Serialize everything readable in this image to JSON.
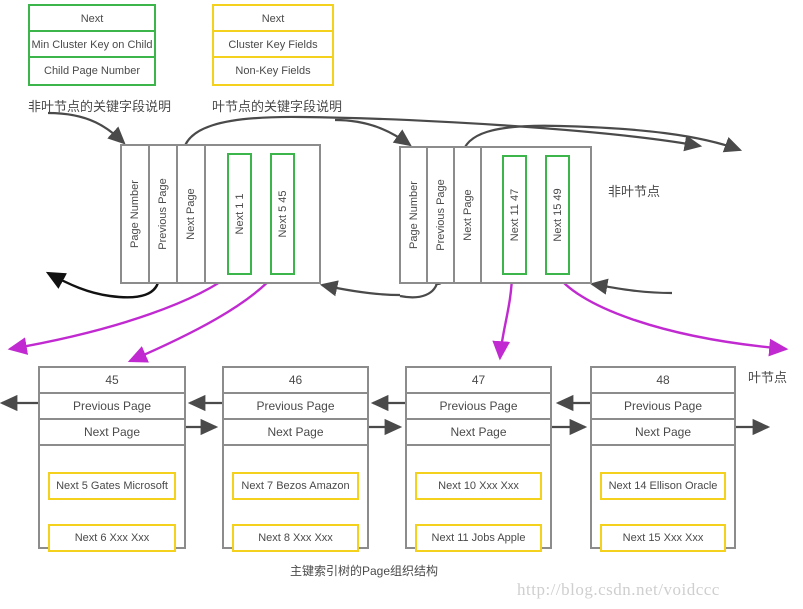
{
  "legend": {
    "nonleaf": {
      "rows": [
        "Next",
        "Min Cluster Key on Child",
        "Child Page Number"
      ],
      "caption": "非叶节点的关键字段说明",
      "color": "#3cb54a"
    },
    "leaf": {
      "rows": [
        "Next",
        "Cluster Key Fields",
        "Non-Key Fields"
      ],
      "caption": "叶节点的关键字段说明",
      "color": "#f3d11c"
    }
  },
  "labels": {
    "nonleaf_level": "非叶节点",
    "leaf_level": "叶节点",
    "caption": "主键索引树的Page组织结构",
    "watermark": "http://blog.csdn.net/voidccc"
  },
  "internal_nodes": [
    {
      "cells": [
        "Page Number",
        "Previous Page",
        "Next Page"
      ],
      "keys": [
        "Next 1 1",
        "Next 5 45"
      ]
    },
    {
      "cells": [
        "Page Number",
        "Previous Page",
        "Next Page"
      ],
      "keys": [
        "Next 11 47",
        "Next 15 49"
      ]
    }
  ],
  "leaf_nodes": [
    {
      "page_number": "45",
      "previous_page": "Previous Page",
      "next_page": "Next Page",
      "records": [
        "Next 5 Gates Microsoft",
        "Next 6 Xxx Xxx"
      ]
    },
    {
      "page_number": "46",
      "previous_page": "Previous Page",
      "next_page": "Next Page",
      "records": [
        "Next 7 Bezos Amazon",
        "Next 8 Xxx Xxx"
      ]
    },
    {
      "page_number": "47",
      "previous_page": "Previous Page",
      "next_page": "Next Page",
      "records": [
        "Next 10 Xxx Xxx",
        "Next 11 Jobs Apple"
      ]
    },
    {
      "page_number": "48",
      "previous_page": "Previous Page",
      "next_page": "Next Page",
      "records": [
        "Next 14 Ellison Oracle",
        "Next 15 Xxx Xxx"
      ]
    }
  ],
  "colors": {
    "green": "#3cb54a",
    "yellow": "#f3d11c",
    "gray": "#8c8c8c",
    "arrow_dark": "#4a4a4a",
    "arrow_black": "#111111",
    "magenta": "#c02ad0"
  }
}
